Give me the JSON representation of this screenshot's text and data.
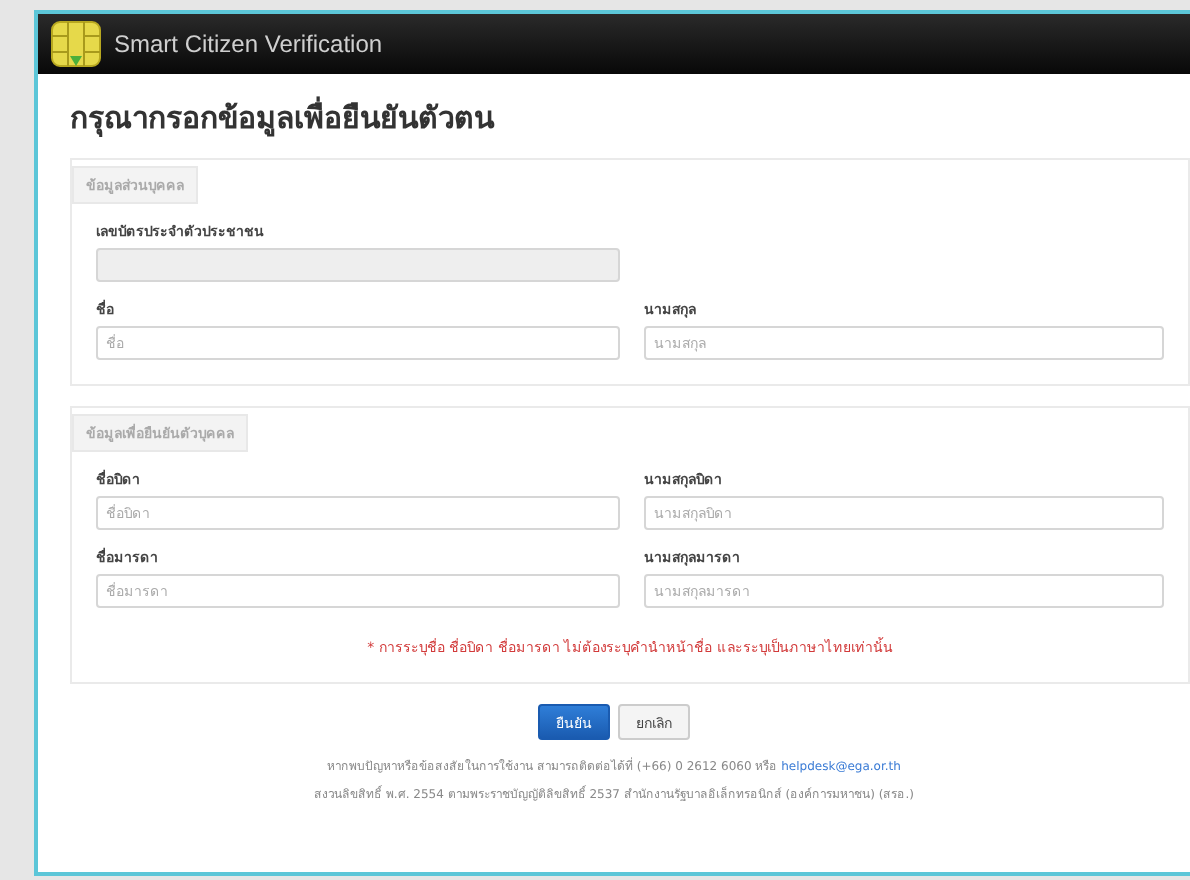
{
  "window": {
    "title": "Smart Citizen Verification"
  },
  "heading": "กรุณากรอกข้อมูลเพื่อยืนยันตัวตน",
  "sections": [
    {
      "legend": "ข้อมูลส่วนบุคคล",
      "rows": [
        [
          {
            "label": "เลขบัตรประจำตัวประชาชน",
            "disabled": true
          }
        ],
        [
          {
            "label": "ชื่อ",
            "placeholder": "ชื่อ",
            "disabled": false
          },
          {
            "label": "นามสกุล",
            "placeholder": "นามสกุล",
            "disabled": false
          }
        ]
      ]
    },
    {
      "legend": "ข้อมูลเพื่อยืนยันตัวบุคคล",
      "rows": [
        [
          {
            "label": "ชื่อบิดา",
            "placeholder": "ชื่อบิดา",
            "disabled": false
          },
          {
            "label": "นามสกุลบิดา",
            "placeholder": "นามสกุลบิดา",
            "disabled": false
          }
        ],
        [
          {
            "label": "ชื่อมารดา",
            "placeholder": "ชื่อมารดา",
            "disabled": false
          },
          {
            "label": "นามสกุลมารดา",
            "placeholder": "นามสกุลมารดา",
            "disabled": false
          }
        ]
      ],
      "note": "* การระบุชื่อ ชื่อบิดา ชื่อมารดา ไม่ต้องระบุคำนำหน้าชื่อ และระบุเป็นภาษาไทยเท่านั้น"
    }
  ],
  "buttons": [
    {
      "label": "ยืนยัน",
      "kind": "primary"
    },
    {
      "label": "ยกเลิก",
      "kind": "default"
    }
  ],
  "footer": {
    "line1": "หากพบปัญหาหรือข้อสงสัยในการใช้งาน สามารถติดต่อได้ที่ (+66) 0 2612 6060 หรือ",
    "email": "helpdesk@ega.or.th",
    "line2": "สงวนลิขสิทธิ์ พ.ศ. 2554 ตามพระราชบัญญัติลิขสิทธิ์ 2537 สำนักงานรัฐบาลอิเล็กทรอนิกส์ (องค์การมหาชน) (สรอ.)"
  }
}
